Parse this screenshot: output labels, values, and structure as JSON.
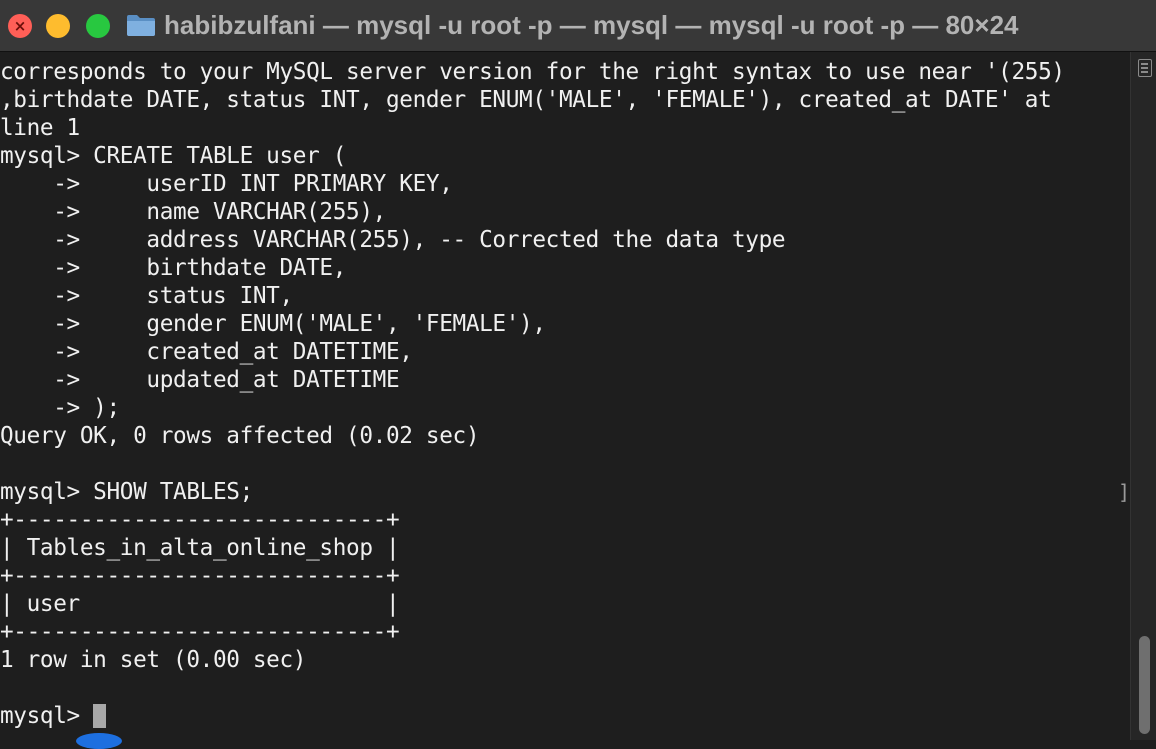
{
  "window": {
    "title": "habibzulfani — mysql -u root -p — mysql — mysql -u root -p — 80×24",
    "close_glyph": "×",
    "icons": {
      "close": "close-icon",
      "minimize": "minimize-icon",
      "maximize": "maximize-icon",
      "folder": "folder-icon",
      "scroll_menu": "hamburger-menu-icon"
    },
    "colors": {
      "close": "#ff5f57",
      "minimize": "#febc2e",
      "maximize": "#28c840",
      "background": "#1e1e1e",
      "text": "#f0f0f0",
      "titlebar": "#383838"
    }
  },
  "terminal": {
    "lines": [
      "corresponds to your MySQL server version for the right syntax to use near '(255)",
      ",birthdate DATE, status INT, gender ENUM('MALE', 'FEMALE'), created_at DATE' at",
      "line 1",
      "mysql> CREATE TABLE user (",
      "    ->     userID INT PRIMARY KEY,",
      "    ->     name VARCHAR(255),",
      "    ->     address VARCHAR(255), -- Corrected the data type",
      "    ->     birthdate DATE,",
      "    ->     status INT,",
      "    ->     gender ENUM('MALE', 'FEMALE'),",
      "    ->     created_at DATETIME,",
      "    ->     updated_at DATETIME",
      "    -> );",
      "Query OK, 0 rows affected (0.02 sec)",
      "",
      "mysql> SHOW TABLES;",
      "+----------------------------+",
      "| Tables_in_alta_online_shop |",
      "+----------------------------+",
      "| user                       |",
      "+----------------------------+",
      "1 row in set (0.00 sec)",
      ""
    ],
    "prompt": "mysql> ",
    "side_mark": "]"
  }
}
